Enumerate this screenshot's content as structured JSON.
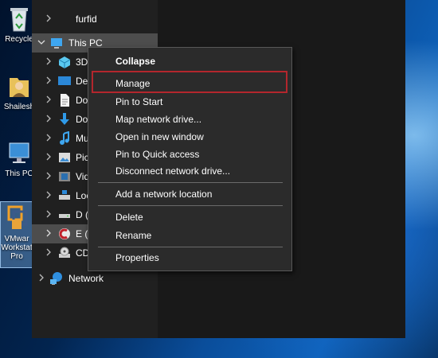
{
  "desktop": {
    "recycle_bin": "Recycle",
    "user_folder": "Shailesh",
    "this_pc": "This PC",
    "vmware_line1": "VMwar",
    "vmware_line2": "Workstat",
    "vmware_line3": "Pro"
  },
  "nav": {
    "top_item": "furfid",
    "this_pc": "This PC",
    "items": [
      {
        "label": "3D",
        "icon": "3d-objects-icon"
      },
      {
        "label": "Des",
        "icon": "desktop-icon"
      },
      {
        "label": "Do",
        "icon": "documents-icon"
      },
      {
        "label": "Do",
        "icon": "downloads-icon"
      },
      {
        "label": "Mu",
        "icon": "music-icon"
      },
      {
        "label": "Pic",
        "icon": "pictures-icon"
      },
      {
        "label": "Vid",
        "icon": "videos-icon"
      },
      {
        "label": "Loc",
        "icon": "local-disk-icon"
      },
      {
        "label": "D (",
        "icon": "drive-icon"
      },
      {
        "label": "E (E",
        "icon": "drive-e-icon"
      },
      {
        "label": "CD",
        "icon": "cd-drive-icon"
      }
    ],
    "network": "Network"
  },
  "context_menu": {
    "collapse": "Collapse",
    "manage": "Manage",
    "pin_to_start": "Pin to Start",
    "map_network_drive": "Map network drive...",
    "open_new_window": "Open in new window",
    "pin_quick_access": "Pin to Quick access",
    "disconnect_network_drive": "Disconnect network drive...",
    "add_network_location": "Add a network location",
    "delete": "Delete",
    "rename": "Rename",
    "properties": "Properties"
  },
  "highlight_color": "#b3262d"
}
